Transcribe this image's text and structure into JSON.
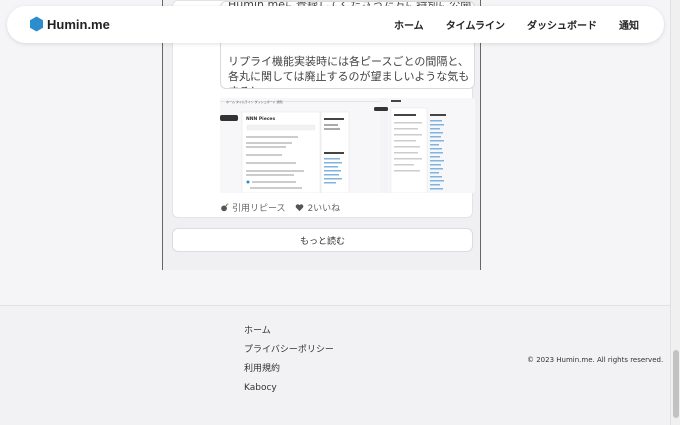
{
  "header": {
    "logo_text": "Humin.me",
    "nav": [
      "ホーム",
      "タイムライン",
      "ダッシュボード",
      "通知"
    ]
  },
  "post": {
    "quote_top_text": "Humin.meに登録してくださった方に特別に公開",
    "quote_body": "リプライ機能実装時には各ピースごとの間隔と、各丸に関しては廃止するのが望ましいような気もする！",
    "actions": {
      "quote_repiece_label": "引用リピース",
      "like_label": "2いいね"
    }
  },
  "screenshot": {
    "header_nav": "ホーム  タイムライン  ダッシュボード  通知",
    "title": "NNN Pieces"
  },
  "load_more_label": "もっと読む",
  "footer": {
    "links": [
      "ホーム",
      "プライバシーポリシー",
      "利用規約",
      "Kabocy"
    ],
    "copyright": "© 2023 Humin.me. All rights reserved."
  },
  "colors": {
    "brand": "#2d8ccc",
    "text": "#222222",
    "background": "#f5f5f7"
  }
}
